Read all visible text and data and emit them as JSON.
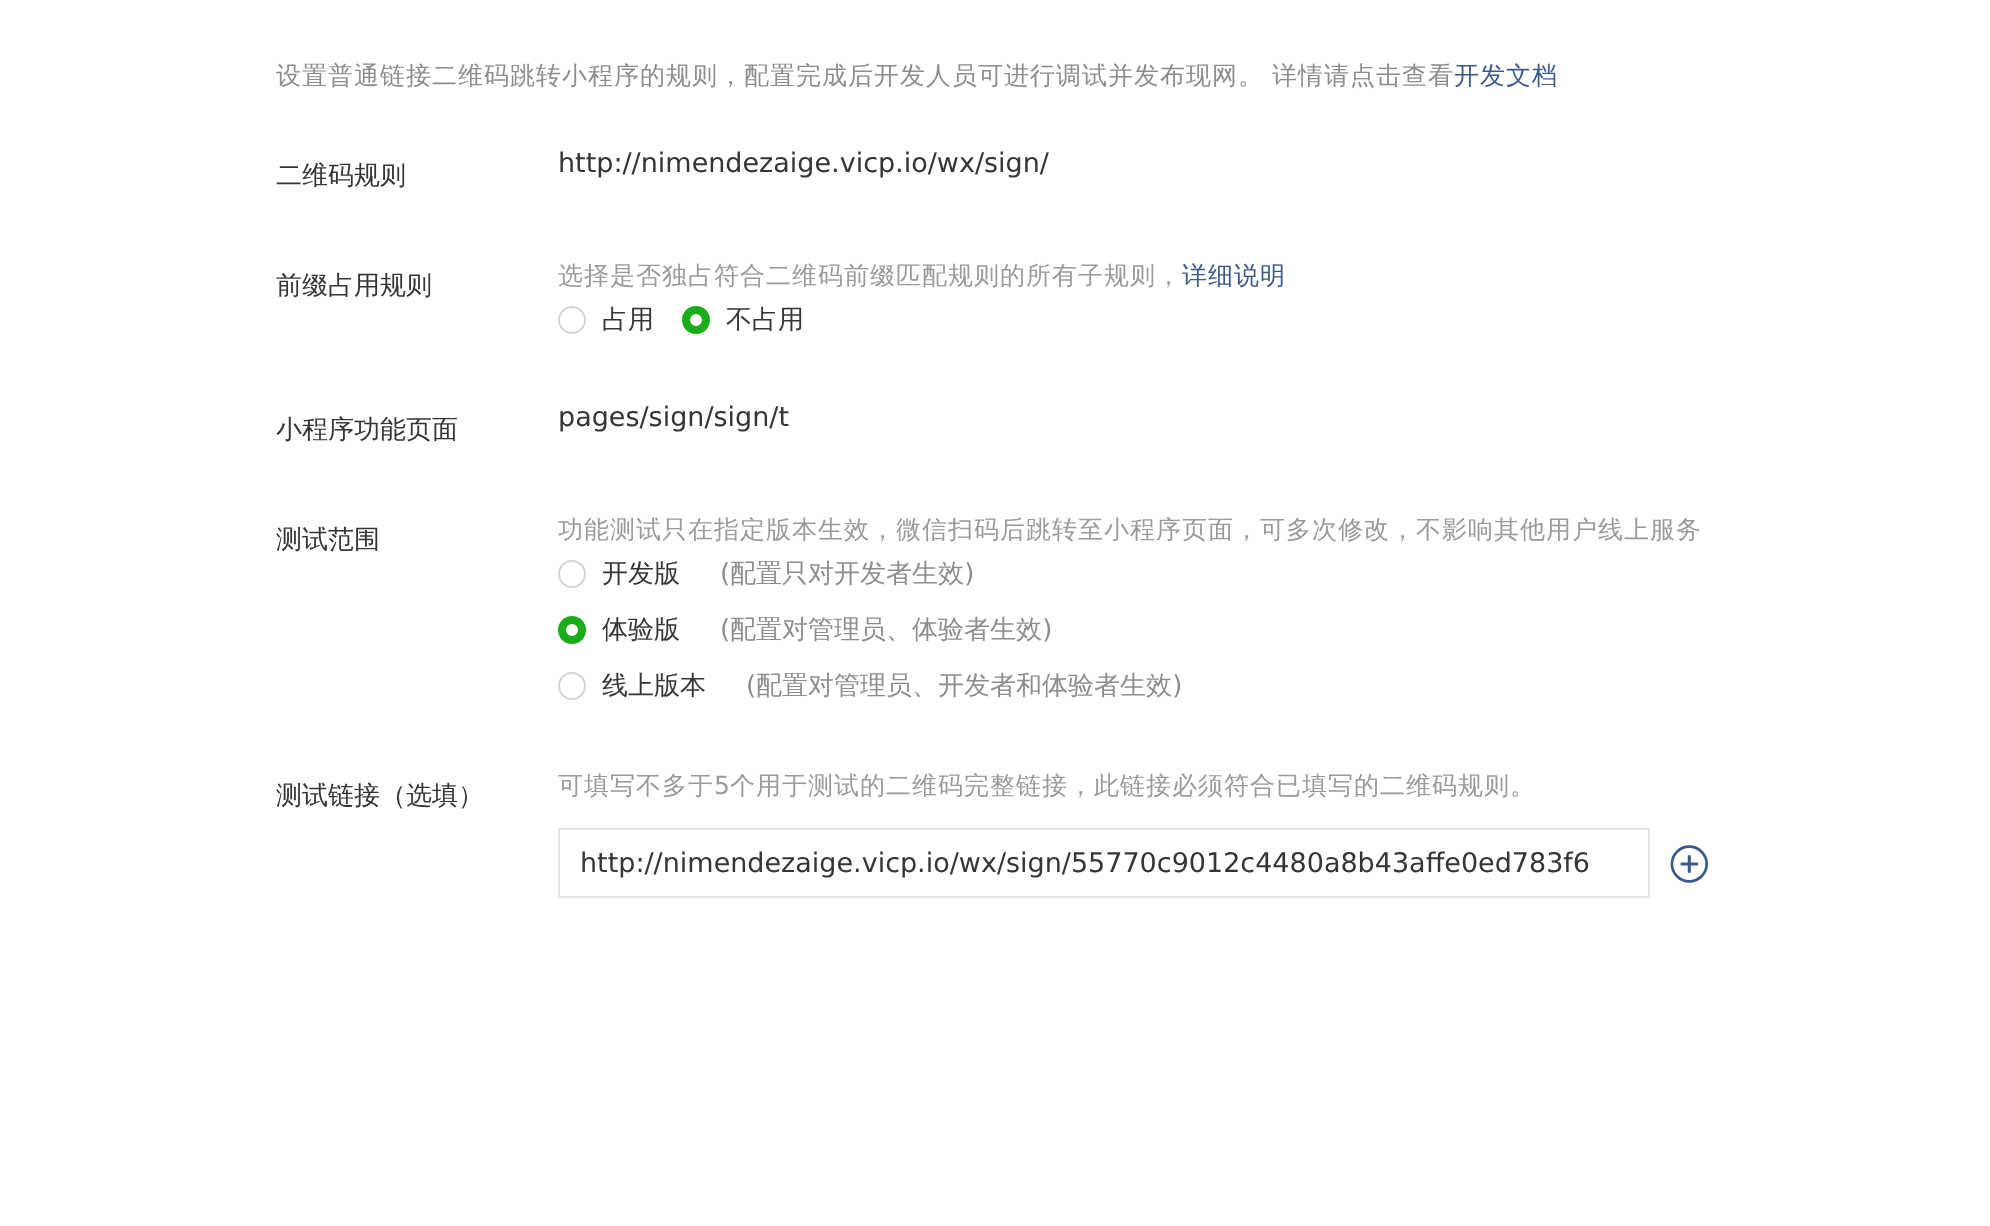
{
  "intro": {
    "text": "设置普通链接二维码跳转小程序的规则，配置完成后开发人员可进行调试并发布现网。 详情请点击查看",
    "link": "开发文档"
  },
  "fields": [
    {
      "kind": "text",
      "label": "二维码规则",
      "value": "http://nimendezaige.vicp.io/wx/sign/"
    },
    {
      "kind": "radio",
      "label": "前缀占用规则",
      "hint": "选择是否独占符合二维码前缀匹配规则的所有子规则，",
      "hint_link": "详细说明",
      "options": [
        {
          "label": "占用",
          "selected": false
        },
        {
          "label": "不占用",
          "selected": true
        }
      ]
    },
    {
      "kind": "text",
      "label": "小程序功能页面",
      "value": "pages/sign/sign/t"
    },
    {
      "kind": "radio",
      "label": "测试范围",
      "hint": "功能测试只在指定版本生效，微信扫码后跳转至小程序页面，可多次修改，不影响其他用户线上服务",
      "options": [
        {
          "label": "开发版",
          "note": "(配置只对开发者生效)",
          "selected": false
        },
        {
          "label": "体验版",
          "note": "(配置对管理员、体验者生效)",
          "selected": true
        },
        {
          "label": "线上版本",
          "note": "(配置对管理员、开发者和体验者生效)",
          "selected": false
        }
      ]
    },
    {
      "kind": "input",
      "label": "测试链接（选填）",
      "hint": "可填写不多于5个用于测试的二维码完整链接，此链接必须符合已填写的二维码规则。",
      "value": "http://nimendezaige.vicp.io/wx/sign/55770c9012c4480a8b43affe0ed783f6"
    }
  ]
}
